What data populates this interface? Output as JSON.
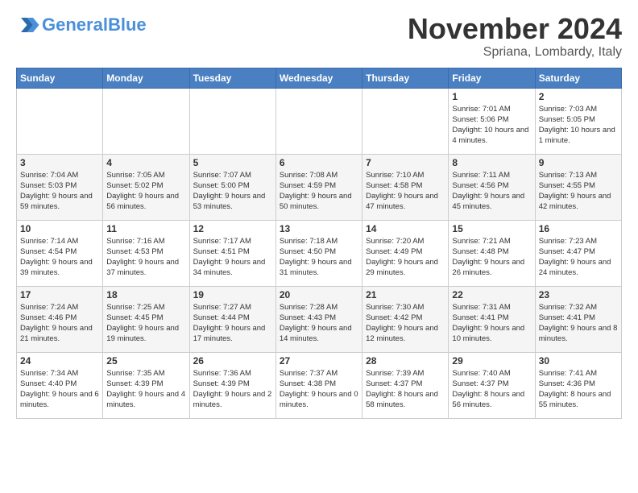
{
  "header": {
    "logo_line1": "General",
    "logo_line2": "Blue",
    "month": "November 2024",
    "location": "Spriana, Lombardy, Italy"
  },
  "days_of_week": [
    "Sunday",
    "Monday",
    "Tuesday",
    "Wednesday",
    "Thursday",
    "Friday",
    "Saturday"
  ],
  "weeks": [
    [
      {
        "day": "",
        "info": ""
      },
      {
        "day": "",
        "info": ""
      },
      {
        "day": "",
        "info": ""
      },
      {
        "day": "",
        "info": ""
      },
      {
        "day": "",
        "info": ""
      },
      {
        "day": "1",
        "info": "Sunrise: 7:01 AM\nSunset: 5:06 PM\nDaylight: 10 hours and 4 minutes."
      },
      {
        "day": "2",
        "info": "Sunrise: 7:03 AM\nSunset: 5:05 PM\nDaylight: 10 hours and 1 minute."
      }
    ],
    [
      {
        "day": "3",
        "info": "Sunrise: 7:04 AM\nSunset: 5:03 PM\nDaylight: 9 hours and 59 minutes."
      },
      {
        "day": "4",
        "info": "Sunrise: 7:05 AM\nSunset: 5:02 PM\nDaylight: 9 hours and 56 minutes."
      },
      {
        "day": "5",
        "info": "Sunrise: 7:07 AM\nSunset: 5:00 PM\nDaylight: 9 hours and 53 minutes."
      },
      {
        "day": "6",
        "info": "Sunrise: 7:08 AM\nSunset: 4:59 PM\nDaylight: 9 hours and 50 minutes."
      },
      {
        "day": "7",
        "info": "Sunrise: 7:10 AM\nSunset: 4:58 PM\nDaylight: 9 hours and 47 minutes."
      },
      {
        "day": "8",
        "info": "Sunrise: 7:11 AM\nSunset: 4:56 PM\nDaylight: 9 hours and 45 minutes."
      },
      {
        "day": "9",
        "info": "Sunrise: 7:13 AM\nSunset: 4:55 PM\nDaylight: 9 hours and 42 minutes."
      }
    ],
    [
      {
        "day": "10",
        "info": "Sunrise: 7:14 AM\nSunset: 4:54 PM\nDaylight: 9 hours and 39 minutes."
      },
      {
        "day": "11",
        "info": "Sunrise: 7:16 AM\nSunset: 4:53 PM\nDaylight: 9 hours and 37 minutes."
      },
      {
        "day": "12",
        "info": "Sunrise: 7:17 AM\nSunset: 4:51 PM\nDaylight: 9 hours and 34 minutes."
      },
      {
        "day": "13",
        "info": "Sunrise: 7:18 AM\nSunset: 4:50 PM\nDaylight: 9 hours and 31 minutes."
      },
      {
        "day": "14",
        "info": "Sunrise: 7:20 AM\nSunset: 4:49 PM\nDaylight: 9 hours and 29 minutes."
      },
      {
        "day": "15",
        "info": "Sunrise: 7:21 AM\nSunset: 4:48 PM\nDaylight: 9 hours and 26 minutes."
      },
      {
        "day": "16",
        "info": "Sunrise: 7:23 AM\nSunset: 4:47 PM\nDaylight: 9 hours and 24 minutes."
      }
    ],
    [
      {
        "day": "17",
        "info": "Sunrise: 7:24 AM\nSunset: 4:46 PM\nDaylight: 9 hours and 21 minutes."
      },
      {
        "day": "18",
        "info": "Sunrise: 7:25 AM\nSunset: 4:45 PM\nDaylight: 9 hours and 19 minutes."
      },
      {
        "day": "19",
        "info": "Sunrise: 7:27 AM\nSunset: 4:44 PM\nDaylight: 9 hours and 17 minutes."
      },
      {
        "day": "20",
        "info": "Sunrise: 7:28 AM\nSunset: 4:43 PM\nDaylight: 9 hours and 14 minutes."
      },
      {
        "day": "21",
        "info": "Sunrise: 7:30 AM\nSunset: 4:42 PM\nDaylight: 9 hours and 12 minutes."
      },
      {
        "day": "22",
        "info": "Sunrise: 7:31 AM\nSunset: 4:41 PM\nDaylight: 9 hours and 10 minutes."
      },
      {
        "day": "23",
        "info": "Sunrise: 7:32 AM\nSunset: 4:41 PM\nDaylight: 9 hours and 8 minutes."
      }
    ],
    [
      {
        "day": "24",
        "info": "Sunrise: 7:34 AM\nSunset: 4:40 PM\nDaylight: 9 hours and 6 minutes."
      },
      {
        "day": "25",
        "info": "Sunrise: 7:35 AM\nSunset: 4:39 PM\nDaylight: 9 hours and 4 minutes."
      },
      {
        "day": "26",
        "info": "Sunrise: 7:36 AM\nSunset: 4:39 PM\nDaylight: 9 hours and 2 minutes."
      },
      {
        "day": "27",
        "info": "Sunrise: 7:37 AM\nSunset: 4:38 PM\nDaylight: 9 hours and 0 minutes."
      },
      {
        "day": "28",
        "info": "Sunrise: 7:39 AM\nSunset: 4:37 PM\nDaylight: 8 hours and 58 minutes."
      },
      {
        "day": "29",
        "info": "Sunrise: 7:40 AM\nSunset: 4:37 PM\nDaylight: 8 hours and 56 minutes."
      },
      {
        "day": "30",
        "info": "Sunrise: 7:41 AM\nSunset: 4:36 PM\nDaylight: 8 hours and 55 minutes."
      }
    ]
  ]
}
